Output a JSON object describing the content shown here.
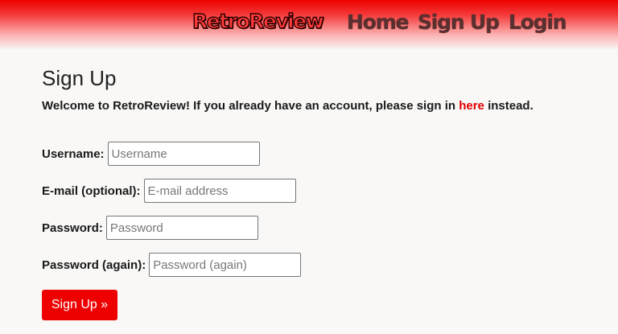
{
  "header": {
    "brand": "RetroReview",
    "nav": {
      "home": "Home",
      "signup": "Sign Up",
      "login": "Login"
    }
  },
  "main": {
    "title": "Sign Up",
    "intro_prefix": "Welcome to RetroReview! If you already have an account, please sign in ",
    "intro_link": "here",
    "intro_suffix": " instead."
  },
  "form": {
    "username": {
      "label": "Username:",
      "placeholder": "Username",
      "value": ""
    },
    "email": {
      "label": "E-mail (optional):",
      "placeholder": "E-mail address",
      "value": ""
    },
    "password": {
      "label": "Password:",
      "placeholder": "Password",
      "value": ""
    },
    "password2": {
      "label": "Password (again):",
      "placeholder": "Password (again)",
      "value": ""
    },
    "submit_label": "Sign Up »"
  },
  "colors": {
    "accent": "#ee0000",
    "link": "#e00000",
    "nav_text": "#5a2f2f"
  }
}
